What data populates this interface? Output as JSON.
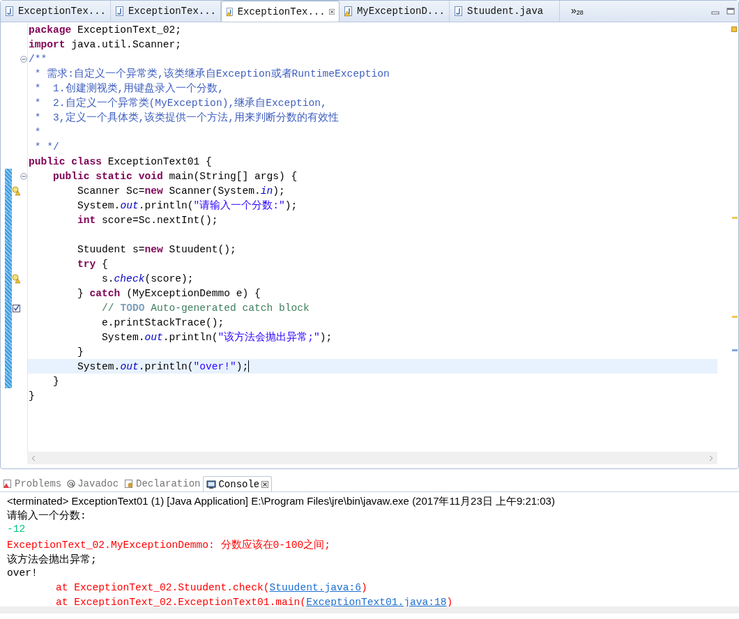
{
  "editor_tabs": [
    {
      "label": "ExceptionTex...",
      "selected": false,
      "warning": false,
      "closable": false
    },
    {
      "label": "ExceptionTex...",
      "selected": false,
      "warning": false,
      "closable": false
    },
    {
      "label": "ExceptionTex...",
      "selected": true,
      "warning": true,
      "closable": true
    },
    {
      "label": "MyExceptionD...",
      "selected": false,
      "warning": true,
      "closable": false
    },
    {
      "label": "Stuudent.java",
      "selected": false,
      "warning": false,
      "closable": false
    }
  ],
  "overflow": {
    "symbol": "»",
    "count": "28"
  },
  "code_lines": [
    {
      "kind": "plain",
      "segments": [
        {
          "kind": "kw",
          "text": "package"
        },
        {
          "kind": "plain",
          "text": " ExceptionText_02;"
        }
      ]
    },
    {
      "kind": "plain",
      "segments": [
        {
          "kind": "kw",
          "text": "import"
        },
        {
          "kind": "plain",
          "text": " java.util.Scanner;"
        }
      ]
    },
    {
      "kind": "plain",
      "fold": true,
      "segments": [
        {
          "kind": "doc",
          "text": "/**"
        }
      ]
    },
    {
      "kind": "plain",
      "segments": [
        {
          "kind": "doc",
          "text": " * 需求:自定义一个异常类,该类继承自Exception或者RuntimeException"
        }
      ]
    },
    {
      "kind": "plain",
      "segments": [
        {
          "kind": "doc",
          "text": " *  1.创建测视类,用键盘录入一个分数,"
        }
      ]
    },
    {
      "kind": "plain",
      "segments": [
        {
          "kind": "doc",
          "text": " *  2.自定义一个异常类(MyException),继承自Exception,"
        }
      ]
    },
    {
      "kind": "plain",
      "segments": [
        {
          "kind": "doc",
          "text": " *  3,定义一个具体类,该类提供一个方法,用来判断分数的有效性"
        }
      ]
    },
    {
      "kind": "plain",
      "segments": [
        {
          "kind": "doc",
          "text": " *"
        }
      ]
    },
    {
      "kind": "plain",
      "segments": [
        {
          "kind": "doc",
          "text": " * */"
        }
      ]
    },
    {
      "kind": "plain",
      "segments": [
        {
          "kind": "kw",
          "text": "public class"
        },
        {
          "kind": "plain",
          "text": " ExceptionText01 {"
        }
      ]
    },
    {
      "kind": "plain",
      "fold": true,
      "changed": true,
      "segments": [
        {
          "kind": "kw",
          "text": "    public static void"
        },
        {
          "kind": "plain",
          "text": " main(String[] args) {"
        }
      ]
    },
    {
      "kind": "warning",
      "changed": true,
      "segments": [
        {
          "kind": "plain",
          "text": "        Scanner Sc="
        },
        {
          "kind": "kw",
          "text": "new"
        },
        {
          "kind": "plain",
          "text": " Scanner(System."
        },
        {
          "kind": "field",
          "text": "in"
        },
        {
          "kind": "plain",
          "text": ");"
        }
      ]
    },
    {
      "kind": "plain",
      "changed": true,
      "segments": [
        {
          "kind": "plain",
          "text": "        System."
        },
        {
          "kind": "field",
          "text": "out"
        },
        {
          "kind": "plain",
          "text": ".println("
        },
        {
          "kind": "string",
          "text": "\"请输入一个分数:\""
        },
        {
          "kind": "plain",
          "text": ");"
        }
      ]
    },
    {
      "kind": "plain",
      "changed": true,
      "segments": [
        {
          "kind": "kw",
          "text": "        int"
        },
        {
          "kind": "plain",
          "text": " score=Sc.nextInt();"
        }
      ]
    },
    {
      "kind": "plain",
      "changed": true
    },
    {
      "kind": "plain",
      "changed": true,
      "segments": [
        {
          "kind": "plain",
          "text": "        Stuudent s="
        },
        {
          "kind": "kw",
          "text": "new"
        },
        {
          "kind": "plain",
          "text": " Stuudent();"
        }
      ]
    },
    {
      "kind": "plain",
      "changed": true,
      "segments": [
        {
          "kind": "kw",
          "text": "        try"
        },
        {
          "kind": "plain",
          "text": " {"
        }
      ]
    },
    {
      "kind": "warning",
      "changed": true,
      "segments": [
        {
          "kind": "plain",
          "text": "            s."
        },
        {
          "kind": "field",
          "text": "check"
        },
        {
          "kind": "plain",
          "text": "(score);"
        }
      ]
    },
    {
      "kind": "plain",
      "changed": true,
      "segments": [
        {
          "kind": "plain",
          "text": "        } "
        },
        {
          "kind": "kw",
          "text": "catch"
        },
        {
          "kind": "plain",
          "text": " (MyExceptionDemmo e) {"
        }
      ]
    },
    {
      "kind": "task",
      "changed": true,
      "segments": [
        {
          "kind": "comment",
          "text": "            // "
        },
        {
          "kind": "todo",
          "text": "TODO"
        },
        {
          "kind": "comment",
          "text": " Auto-generated catch block"
        }
      ]
    },
    {
      "kind": "plain",
      "changed": true,
      "segments": [
        {
          "kind": "plain",
          "text": "            e.printStackTrace();"
        }
      ]
    },
    {
      "kind": "plain",
      "changed": true,
      "segments": [
        {
          "kind": "plain",
          "text": "            System."
        },
        {
          "kind": "field",
          "text": "out"
        },
        {
          "kind": "plain",
          "text": ".println("
        },
        {
          "kind": "string",
          "text": "\"该方法会抛出异常;\""
        },
        {
          "kind": "plain",
          "text": ");"
        }
      ]
    },
    {
      "kind": "plain",
      "changed": true,
      "segments": [
        {
          "kind": "plain",
          "text": "        }"
        }
      ]
    },
    {
      "kind": "plain",
      "changed": true,
      "highlighted": true,
      "segments": [
        {
          "kind": "plain",
          "text": "        System."
        },
        {
          "kind": "field",
          "text": "out"
        },
        {
          "kind": "plain",
          "text": ".println("
        },
        {
          "kind": "string",
          "text": "\"over!\""
        },
        {
          "kind": "plain",
          "text": ");"
        }
      ]
    },
    {
      "kind": "plain",
      "changed": true,
      "segments": [
        {
          "kind": "plain",
          "text": "    }"
        }
      ]
    },
    {
      "kind": "plain",
      "segments": [
        {
          "kind": "plain",
          "text": "}"
        }
      ]
    }
  ],
  "view_tabs": [
    {
      "label": "Problems",
      "selected": false,
      "closable": false
    },
    {
      "label": "Javadoc",
      "selected": false,
      "closable": false
    },
    {
      "label": "Declaration",
      "selected": false,
      "closable": false
    },
    {
      "label": "Console",
      "selected": true,
      "closable": true
    }
  ],
  "console": {
    "header": "<terminated> ExceptionText01 (1) [Java Application] E:\\Program Files\\jre\\bin\\javaw.exe (2017年11月23日 上午9:21:03)",
    "lines": [
      [
        {
          "kind": "out",
          "text": "请输入一个分数:"
        }
      ],
      [
        {
          "kind": "input",
          "text": "-12"
        }
      ],
      [
        {
          "kind": "err",
          "text": "ExceptionText_02.MyExceptionDemmo: 分数应该在0-100之间;"
        }
      ],
      [
        {
          "kind": "out",
          "text": "该方法会抛出异常;"
        }
      ],
      [
        {
          "kind": "out",
          "text": "over!"
        }
      ],
      [
        {
          "kind": "err",
          "text": "\tat ExceptionText_02.Stuudent.check("
        },
        {
          "kind": "link",
          "text": "Stuudent.java:6"
        },
        {
          "kind": "err",
          "text": ")"
        }
      ],
      [
        {
          "kind": "err",
          "text": "\tat ExceptionText_02.ExceptionText01.main("
        },
        {
          "kind": "link",
          "text": "ExceptionText01.java:18"
        },
        {
          "kind": "err",
          "text": ")"
        }
      ]
    ]
  }
}
